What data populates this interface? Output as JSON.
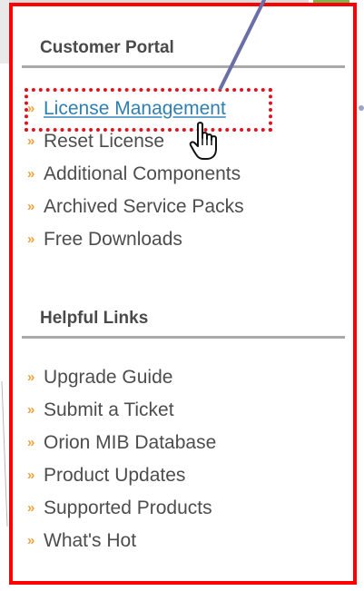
{
  "customer_portal": {
    "title": "Customer Portal",
    "items": [
      {
        "label": "License Management",
        "active": true
      },
      {
        "label": "Reset License",
        "active": false
      },
      {
        "label": "Additional Components",
        "active": false
      },
      {
        "label": "Archived Service Packs",
        "active": false
      },
      {
        "label": "Free Downloads",
        "active": false
      }
    ]
  },
  "helpful_links": {
    "title": "Helpful Links",
    "items": [
      {
        "label": "Upgrade Guide"
      },
      {
        "label": "Submit a Ticket"
      },
      {
        "label": "Orion MIB Database"
      },
      {
        "label": "Product Updates"
      },
      {
        "label": "Supported Products"
      },
      {
        "label": "What's Hot"
      }
    ]
  },
  "bullet_glyph": "»",
  "icons": {
    "cursor": "hand-pointer-icon"
  },
  "colors": {
    "highlight_frame": "#ff0000",
    "selection_box": "#e0141e",
    "bullet": "#f0a23a",
    "active_link": "#2f7fb0",
    "callout_line": "#6a6fa8"
  }
}
